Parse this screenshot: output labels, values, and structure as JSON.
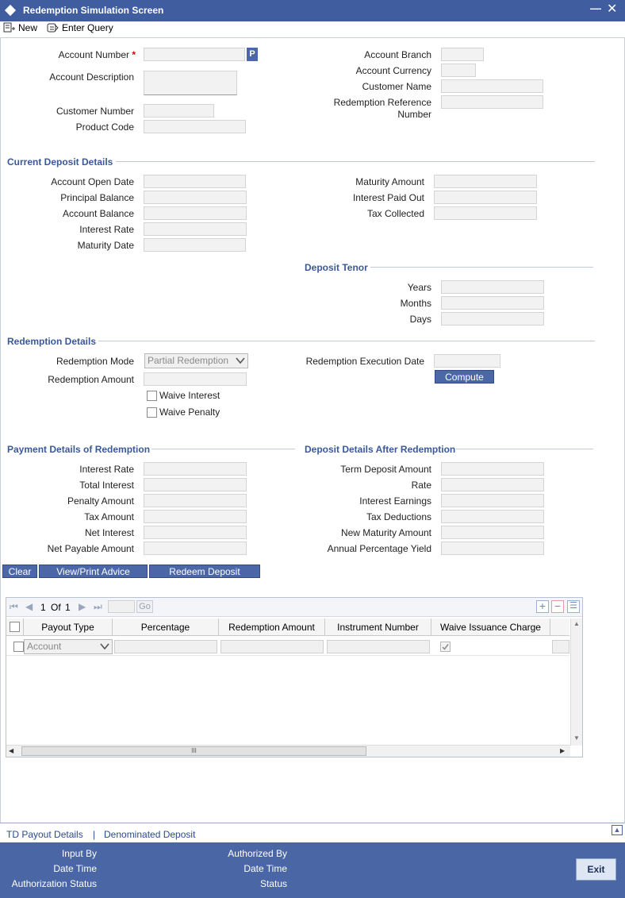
{
  "window": {
    "title": "Redemption Simulation Screen"
  },
  "toolbar": {
    "new_label": "New",
    "enter_query_label": "Enter Query"
  },
  "header": {
    "account_number_label": "Account Number",
    "required_mark": "*",
    "lov_button_label": "P",
    "account_description_label": "Account Description",
    "customer_number_label": "Customer Number",
    "product_code_label": "Product Code",
    "account_branch_label": "Account Branch",
    "account_currency_label": "Account Currency",
    "customer_name_label": "Customer Name",
    "redemption_reference_label_line1": "Redemption Reference",
    "redemption_reference_label_line2": "Number"
  },
  "current_deposit": {
    "section_title": "Current Deposit Details",
    "account_open_date_label": "Account Open Date",
    "principal_balance_label": "Principal Balance",
    "account_balance_label": "Account Balance",
    "interest_rate_label": "Interest Rate",
    "maturity_date_label": "Maturity Date",
    "maturity_amount_label": "Maturity Amount",
    "interest_paid_out_label": "Interest Paid Out",
    "tax_collected_label": "Tax Collected"
  },
  "deposit_tenor": {
    "section_title": "Deposit Tenor",
    "years_label": "Years",
    "months_label": "Months",
    "days_label": "Days"
  },
  "redemption": {
    "section_title": "Redemption Details",
    "mode_label": "Redemption Mode",
    "mode_value": "Partial Redemption",
    "amount_label": "Redemption Amount",
    "waive_interest_label": "Waive Interest",
    "waive_penalty_label": "Waive Penalty",
    "execution_date_label": "Redemption Execution Date",
    "compute_label": "Compute"
  },
  "payment_details": {
    "section_title": "Payment Details of Redemption",
    "interest_rate_label": "Interest Rate",
    "total_interest_label": "Total Interest",
    "penalty_amount_label": "Penalty Amount",
    "tax_amount_label": "Tax Amount",
    "net_interest_label": "Net Interest",
    "net_payable_label": "Net Payable Amount"
  },
  "after_redemption": {
    "section_title": "Deposit Details After Redemption",
    "term_deposit_amount_label": "Term Deposit Amount",
    "rate_label": "Rate",
    "interest_earnings_label": "Interest Earnings",
    "tax_deductions_label": "Tax Deductions",
    "new_maturity_amount_label": "New Maturity Amount",
    "apy_label": "Annual Percentage Yield"
  },
  "actions": {
    "clear_label": "Clear",
    "view_print_label": "View/Print Advice",
    "redeem_label": "Redeem Deposit"
  },
  "grid": {
    "page_current": "1",
    "page_of": "Of",
    "page_total": "1",
    "go_label": "Go",
    "columns": [
      "Payout Type",
      "Percentage",
      "Redemption Amount",
      "Instrument Number",
      "Waive Issuance Charge"
    ],
    "row_payout_type": "Account",
    "scroll_thumb_glyph": "III"
  },
  "footer_links": {
    "td_payout_label": "TD Payout Details",
    "separator": "|",
    "denominated_label": "Denominated Deposit"
  },
  "audit": {
    "input_by_label": "Input By",
    "date_time_label": "Date Time",
    "authorization_status_label": "Authorization Status",
    "authorized_by_label": "Authorized By",
    "date_time2_label": "Date Time",
    "status_label": "Status",
    "exit_label": "Exit"
  }
}
